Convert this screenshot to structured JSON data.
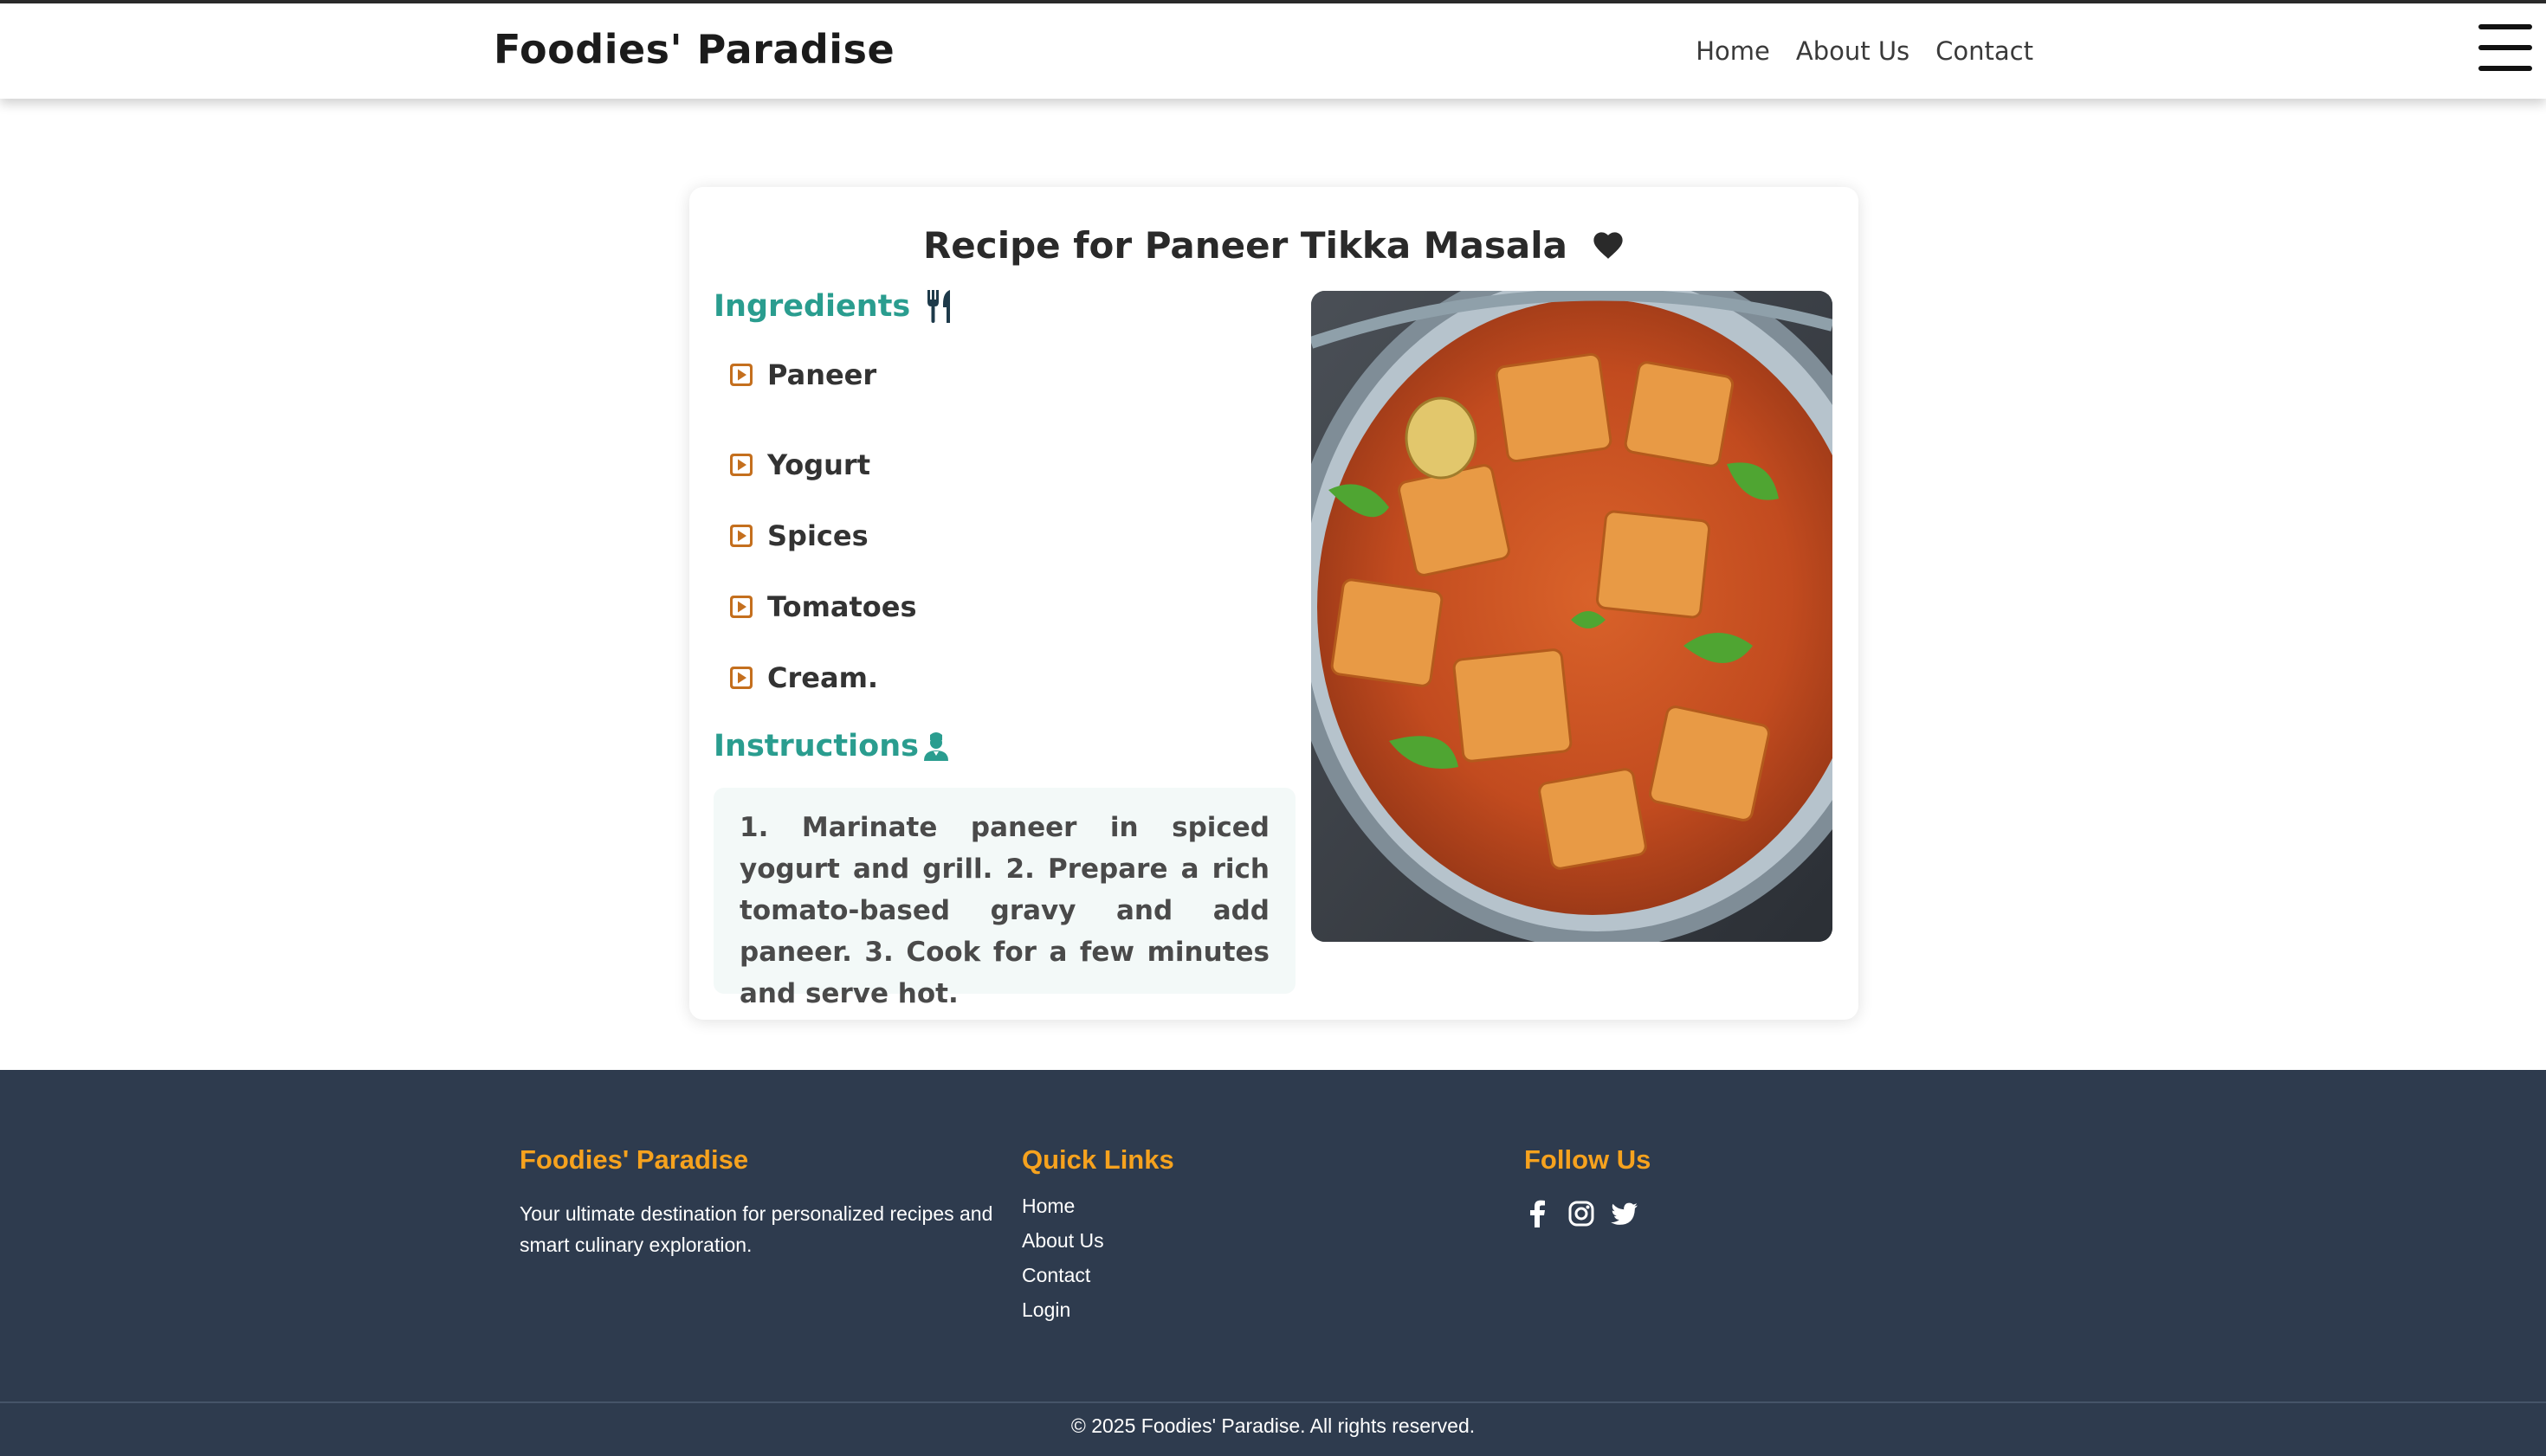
{
  "header": {
    "brand": "Foodies' Paradise",
    "nav": [
      "Home",
      "About Us",
      "Contact"
    ],
    "menu_icon": "hamburger-menu-icon"
  },
  "recipe": {
    "title": "Recipe for Paneer Tikka Masala",
    "favorite_icon": "heart-icon",
    "ingredients_heading": "Ingredients",
    "ingredients_icon": "utensils-icon",
    "ingredients": [
      "Paneer",
      "Yogurt",
      "Spices",
      "Tomatoes",
      "Cream."
    ],
    "bullet_icon": "caret-square-right-icon",
    "instructions_heading": "Instructions",
    "instructions_icon": "chef-icon",
    "instructions": "1. Marinate paneer in spiced yogurt and grill. 2. Prepare a rich tomato-based gravy and add paneer. 3. Cook for a few minutes and serve hot.",
    "image_subject": "paneer-tikka-masala-photo"
  },
  "footer": {
    "brand_title": "Foodies' Paradise",
    "brand_text": "Your ultimate destination for personalized recipes and smart culinary exploration.",
    "links_title": "Quick Links",
    "links": [
      "Home",
      "About Us",
      "Contact",
      "Login"
    ],
    "follow_title": "Follow Us",
    "social_icons": [
      "facebook-icon",
      "instagram-icon",
      "twitter-icon"
    ],
    "copyright": "© 2025 Foodies' Paradise. All rights reserved."
  },
  "colors": {
    "accent_teal": "#2a9d8f",
    "bullet_orange": "#c46f1e",
    "footer_bg": "#2e3b4e",
    "footer_heading": "#f6a21e"
  }
}
